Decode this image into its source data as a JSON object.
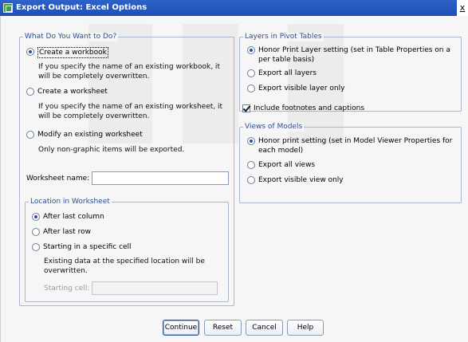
{
  "window": {
    "title": "Export Output: Excel Options",
    "close_label": "x"
  },
  "left": {
    "legend": "What Do You Want to Do?",
    "options": [
      {
        "label": "Create a workbook",
        "checked": true,
        "focused": true,
        "desc": "If you specify the name of an existing workbook, it will be completely overwritten."
      },
      {
        "label": "Create a worksheet",
        "checked": false,
        "desc": "If you specify the name of an existing worksheet, it will be completely overwritten."
      },
      {
        "label": "Modify an existing worksheet",
        "checked": false,
        "desc": "Only non-graphic items will be exported."
      }
    ],
    "worksheet_name_label": "Worksheet name:",
    "worksheet_name_value": ""
  },
  "location": {
    "legend": "Location in Worksheet",
    "options": [
      {
        "label": "After last column",
        "checked": true
      },
      {
        "label": "After last row",
        "checked": false
      },
      {
        "label": "Starting in a specific cell",
        "checked": false
      }
    ],
    "note": "Existing data at the specified location will be overwritten.",
    "starting_cell_label": "Starting cell:",
    "starting_cell_value": ""
  },
  "layers": {
    "legend": "Layers in Pivot Tables",
    "options": [
      {
        "label": "Honor Print Layer setting (set in Table Properties on a per table basis)",
        "checked": true
      },
      {
        "label": "Export all layers",
        "checked": false
      },
      {
        "label": "Export visible layer only",
        "checked": false
      }
    ]
  },
  "footnotes": {
    "label": "Include footnotes and captions",
    "checked": true
  },
  "models": {
    "legend": "Views of Models",
    "options": [
      {
        "label": "Honor print setting (set in Model Viewer Properties for each model)",
        "checked": true
      },
      {
        "label": "Export all views",
        "checked": false
      },
      {
        "label": "Export visible view only",
        "checked": false
      }
    ]
  },
  "buttons": {
    "continue": "Continue",
    "reset": "Reset",
    "cancel": "Cancel",
    "help": "Help"
  }
}
